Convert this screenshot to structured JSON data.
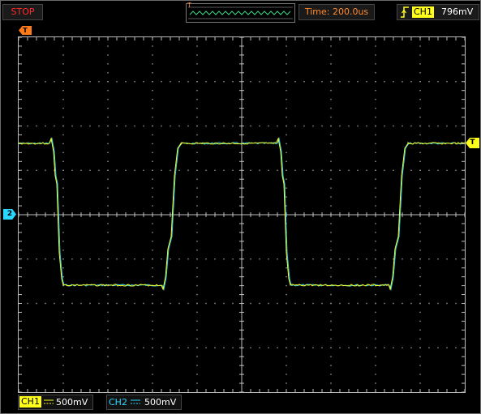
{
  "header": {
    "run_status": "STOP",
    "time_label": "Time: 200.0us",
    "trigger": {
      "edge_icon": "rising-edge-icon",
      "channel": "CH1",
      "level": "796mV"
    },
    "preview_marker": "T"
  },
  "markers": {
    "trigger_position": "T",
    "ch2_ground": "2",
    "trigger_level": "T"
  },
  "footer": {
    "ch1": {
      "label": "CH1",
      "coupling_icon": "dc-coupling-icon",
      "scale": "500mV"
    },
    "ch2": {
      "label": "CH2",
      "coupling_icon": "dc-coupling-icon",
      "scale": "500mV"
    }
  },
  "colors": {
    "background": "#000000",
    "grid": "#9a9a9a",
    "ch1": "#ffff1a",
    "ch2": "#2ad6ff",
    "trigger_marker": "#ff7b1a",
    "status_stop": "#ff2a2a",
    "time_text": "#ff8a2a"
  }
}
